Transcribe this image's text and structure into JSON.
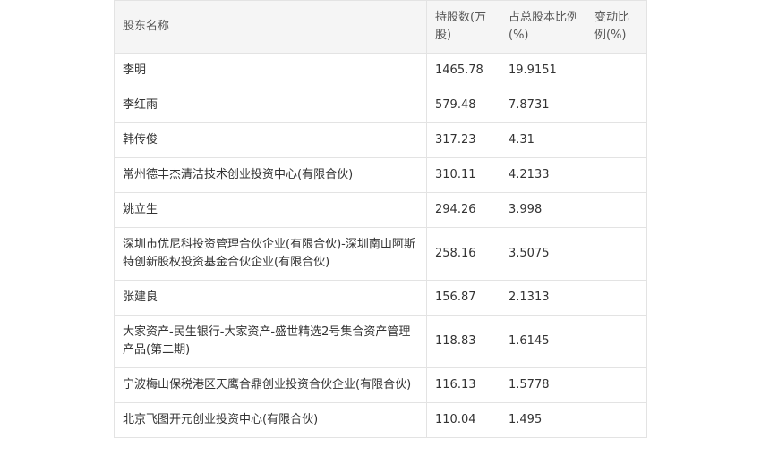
{
  "table": {
    "headers": {
      "name": "股东名称",
      "shares": "持股数(万股)",
      "pct": "占总股本比例(%)",
      "change": "变动比例(%)"
    },
    "rows": [
      {
        "name": "李明",
        "shares": "1465.78",
        "pct": "19.9151",
        "change": ""
      },
      {
        "name": "李红雨",
        "shares": "579.48",
        "pct": "7.8731",
        "change": ""
      },
      {
        "name": "韩传俊",
        "shares": "317.23",
        "pct": "4.31",
        "change": ""
      },
      {
        "name": "常州德丰杰清洁技术创业投资中心(有限合伙)",
        "shares": "310.11",
        "pct": "4.2133",
        "change": ""
      },
      {
        "name": "姚立生",
        "shares": "294.26",
        "pct": "3.998",
        "change": ""
      },
      {
        "name": "深圳市优尼科投资管理合伙企业(有限合伙)-深圳南山阿斯特创新股权投资基金合伙企业(有限合伙)",
        "shares": "258.16",
        "pct": "3.5075",
        "change": ""
      },
      {
        "name": "张建良",
        "shares": "156.87",
        "pct": "2.1313",
        "change": ""
      },
      {
        "name": "大家资产-民生银行-大家资产-盛世精选2号集合资产管理产品(第二期)",
        "shares": "118.83",
        "pct": "1.6145",
        "change": ""
      },
      {
        "name": "宁波梅山保税港区天鹰合鼎创业投资合伙企业(有限合伙)",
        "shares": "116.13",
        "pct": "1.5778",
        "change": ""
      },
      {
        "name": "北京飞图开元创业投资中心(有限合伙)",
        "shares": "110.04",
        "pct": "1.495",
        "change": ""
      }
    ]
  }
}
